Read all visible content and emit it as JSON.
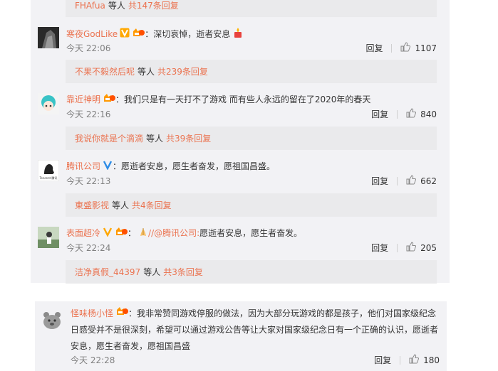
{
  "top_replies": {
    "users": "FHAfua",
    "mid": "等人",
    "count": "共147条回复"
  },
  "comments": [
    {
      "user": "寒夜GodLike",
      "text": "：深切哀悼，逝者安息",
      "time": "今天 22:06",
      "reply": "回复",
      "likes": "1107",
      "replies": {
        "users": "不果不毅然后呢",
        "mid": "等人",
        "count": "共239条回复"
      }
    },
    {
      "user": "靠近神明",
      "text": "：我们只是有一天打不了游戏 而有些人永远的留在了2020年的春天",
      "time": "今天 22:16",
      "reply": "回复",
      "likes": "840",
      "replies": {
        "users": "我说你就是个滴滴",
        "mid": "等人",
        "count": "共39条回复"
      }
    },
    {
      "user": "腾讯公司",
      "text": "：愿逝者安息，愿生者奋发，愿祖国昌盛。",
      "time": "今天 22:13",
      "reply": "回复",
      "likes": "662",
      "avatar_caption": "Tencent 腾讯",
      "replies": {
        "users": "東盛影视",
        "mid": "等人",
        "count": "共4条回复"
      }
    },
    {
      "user": "表面超冷",
      "text_pre": "：",
      "mention": "//@腾讯公司:",
      "text_post": "愿逝者安息，愿生者奋发。",
      "time": "今天 22:24",
      "reply": "回复",
      "likes": "205",
      "replies": {
        "users": "洁净真假_44397",
        "mid": "等人",
        "count": "共3条回复"
      }
    },
    {
      "user": "怪味杨小怪",
      "text": "：我非常赞同游戏停服的做法，因为大部分玩游戏的都是孩子，他们对国家级纪念日感受并不是很深刻，希望可以通过游戏公告等让大家对国家级纪念日有一个正确的认识，愿逝者安息，愿生者奋发，愿祖国昌盛",
      "time": "今天 22:28",
      "reply": "回复",
      "likes": "180"
    }
  ],
  "colors": {
    "accent": "#eb7350",
    "panel": "#f2f2f5",
    "reply_box": "#eaeaec"
  }
}
